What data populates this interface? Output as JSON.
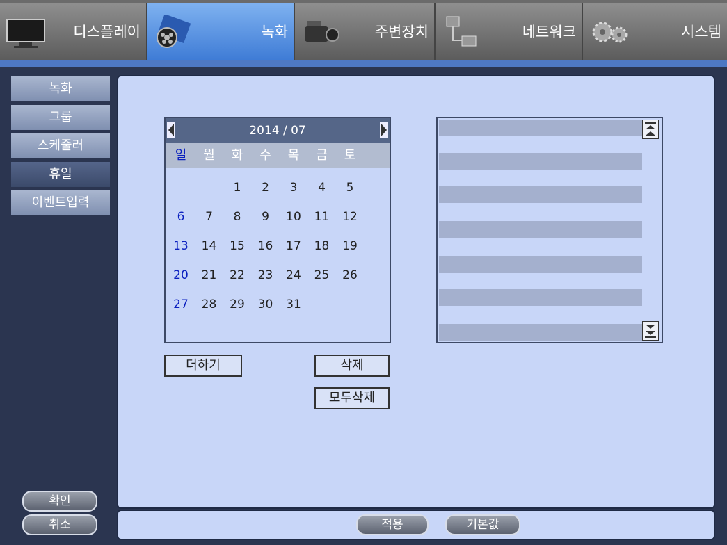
{
  "tabs": [
    {
      "label": "디스플레이",
      "icon": "monitor-icon"
    },
    {
      "label": "녹화",
      "icon": "film-reel-icon"
    },
    {
      "label": "주변장치",
      "icon": "camcorder-icon"
    },
    {
      "label": "네트워크",
      "icon": "network-icon"
    },
    {
      "label": "시스템",
      "icon": "gears-icon"
    }
  ],
  "sidebar": {
    "items": [
      "녹화",
      "그룹",
      "스케줄러",
      "휴일",
      "이벤트입력"
    ],
    "selected": "휴일",
    "ok": "확인",
    "cancel": "취소"
  },
  "calendar": {
    "title": "2014 / 07",
    "weekdays": [
      "일",
      "월",
      "화",
      "수",
      "목",
      "금",
      "토"
    ],
    "days": [
      [
        "",
        "",
        "1",
        "2",
        "3",
        "4",
        "5"
      ],
      [
        "6",
        "7",
        "8",
        "9",
        "10",
        "11",
        "12"
      ],
      [
        "13",
        "14",
        "15",
        "16",
        "17",
        "18",
        "19"
      ],
      [
        "20",
        "21",
        "22",
        "23",
        "24",
        "25",
        "26"
      ],
      [
        "27",
        "28",
        "29",
        "30",
        "31",
        "",
        ""
      ]
    ]
  },
  "actions": {
    "add": "더하기",
    "delete": "삭제",
    "delete_all": "모두삭제"
  },
  "footer": {
    "apply": "적용",
    "default": "기본값"
  },
  "colors": {
    "active_tab": "#3f7cd6",
    "panel": "#c8d6f8",
    "sunday": "#0a1fbf"
  }
}
